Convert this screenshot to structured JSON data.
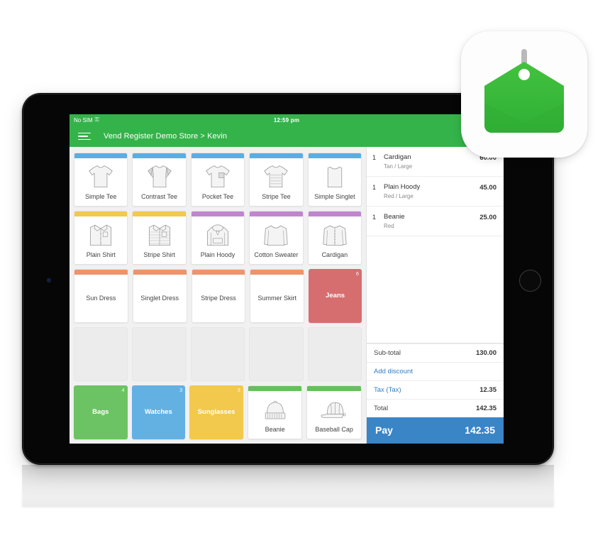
{
  "device": {
    "status_bar": {
      "carrier": "No SIM",
      "wifi_icon": "wifi-icon",
      "time": "12:59 pm"
    },
    "app_bar": {
      "menu_icon": "hamburger-menu-icon",
      "title": "Vend Register Demo Store > Kevin"
    }
  },
  "colors": {
    "header_green": "#34b34a",
    "tee_blue": "#5aaee0",
    "shirt_yellow": "#f2c94c",
    "sweater_purple": "#c185d0",
    "dress_orange": "#f0936b",
    "accessory_green": "#66bf5e",
    "jeans_red": "#d66e70",
    "bags_green": "#6cc363",
    "watches_blue": "#63b1e3",
    "sunglasses_yellow": "#f2c94c",
    "pay_blue": "#3a85c6",
    "link_blue": "#2f7fc4"
  },
  "product_grid": {
    "rows": [
      [
        {
          "name": "Simple Tee",
          "type": "product",
          "art": "tee-simple",
          "accent": "#5aaee0"
        },
        {
          "name": "Contrast Tee",
          "type": "product",
          "art": "tee-contrast",
          "accent": "#5aaee0"
        },
        {
          "name": "Pocket Tee",
          "type": "product",
          "art": "tee-pocket",
          "accent": "#5aaee0"
        },
        {
          "name": "Stripe Tee",
          "type": "product",
          "art": "tee-stripe",
          "accent": "#5aaee0"
        },
        {
          "name": "Simple Singlet",
          "type": "product",
          "art": "singlet",
          "accent": "#5aaee0"
        }
      ],
      [
        {
          "name": "Plain Shirt",
          "type": "product",
          "art": "shirt-plain",
          "accent": "#f2c94c"
        },
        {
          "name": "Stripe Shirt",
          "type": "product",
          "art": "shirt-stripe",
          "accent": "#f2c94c"
        },
        {
          "name": "Plain Hoody",
          "type": "product",
          "art": "hoody",
          "accent": "#c185d0"
        },
        {
          "name": "Cotton Sweater",
          "type": "product",
          "art": "sweater",
          "accent": "#c185d0"
        },
        {
          "name": "Cardigan",
          "type": "product",
          "art": "cardigan",
          "accent": "#c185d0"
        }
      ],
      [
        {
          "name": "Sun Dress",
          "type": "product-textonly",
          "art": "",
          "accent": "#f0936b"
        },
        {
          "name": "Singlet Dress",
          "type": "product-textonly",
          "art": "",
          "accent": "#f0936b"
        },
        {
          "name": "Stripe Dress",
          "type": "product-textonly",
          "art": "",
          "accent": "#f0936b"
        },
        {
          "name": "Summer Skirt",
          "type": "product-textonly",
          "art": "",
          "accent": "#f0936b"
        },
        {
          "name": "Jeans",
          "type": "category",
          "art": "",
          "accent": "#d66e70",
          "badge": "6"
        }
      ],
      [
        {
          "name": "",
          "type": "empty",
          "art": "",
          "accent": ""
        },
        {
          "name": "",
          "type": "empty",
          "art": "",
          "accent": ""
        },
        {
          "name": "",
          "type": "empty",
          "art": "",
          "accent": ""
        },
        {
          "name": "",
          "type": "empty",
          "art": "",
          "accent": ""
        },
        {
          "name": "",
          "type": "empty",
          "art": "",
          "accent": ""
        }
      ],
      [
        {
          "name": "Bags",
          "type": "category",
          "art": "",
          "accent": "#6cc363",
          "badge": "4"
        },
        {
          "name": "Watches",
          "type": "category",
          "art": "",
          "accent": "#63b1e3",
          "badge": "3"
        },
        {
          "name": "Sunglasses",
          "type": "category",
          "art": "",
          "accent": "#f2c94c",
          "badge": "3"
        },
        {
          "name": "Beanie",
          "type": "product",
          "art": "beanie",
          "accent": "#66bf5e"
        },
        {
          "name": "Baseball Cap",
          "type": "product",
          "art": "cap",
          "accent": "#66bf5e"
        }
      ]
    ]
  },
  "cart": {
    "items": [
      {
        "qty": "1",
        "name": "Cardigan",
        "variant": "Tan / Large",
        "price": "60.00"
      },
      {
        "qty": "1",
        "name": "Plain Hoody",
        "variant": "Red / Large",
        "price": "45.00"
      },
      {
        "qty": "1",
        "name": "Beanie",
        "variant": "Red",
        "price": "25.00"
      }
    ],
    "totals": {
      "subtotal_label": "Sub-total",
      "subtotal_value": "130.00",
      "discount_label": "Add discount",
      "tax_label": "Tax (Tax)",
      "tax_value": "12.35",
      "total_label": "Total",
      "total_value": "142.35"
    },
    "pay": {
      "label": "Pay",
      "amount": "142.35"
    }
  },
  "app_icon": {
    "name": "vend-price-tag-icon"
  }
}
